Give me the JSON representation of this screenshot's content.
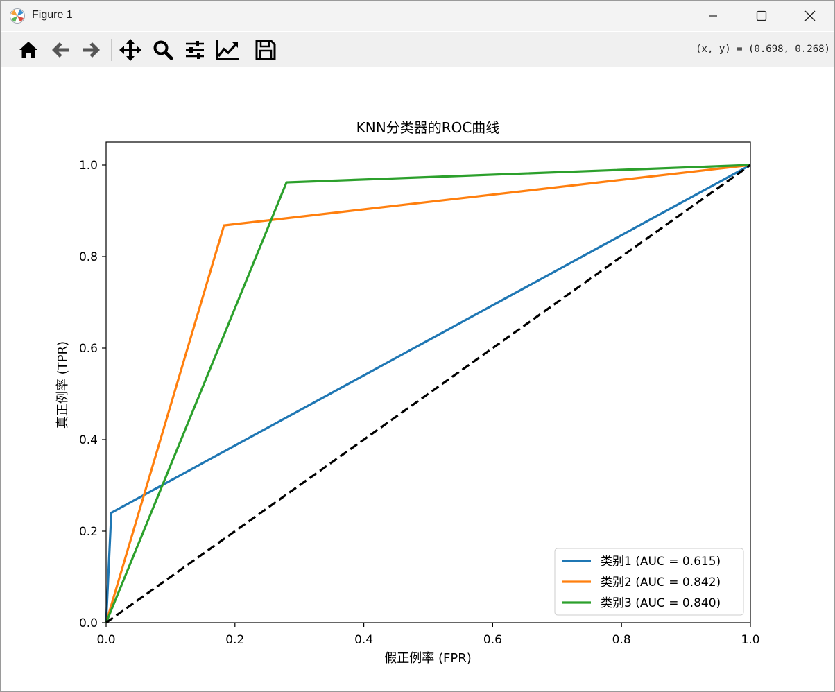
{
  "window": {
    "title": "Figure 1",
    "controls": [
      "minimize",
      "maximize",
      "close"
    ]
  },
  "toolbar": {
    "buttons": [
      {
        "name": "home",
        "icon": "home-icon"
      },
      {
        "name": "back",
        "icon": "arrow-left-icon"
      },
      {
        "name": "forward",
        "icon": "arrow-right-icon"
      },
      {
        "name": "pan",
        "icon": "move-icon"
      },
      {
        "name": "zoom",
        "icon": "zoom-icon"
      },
      {
        "name": "configure-subplots",
        "icon": "sliders-icon"
      },
      {
        "name": "edit-axis",
        "icon": "line-chart-icon"
      },
      {
        "name": "save",
        "icon": "floppy-disk-icon"
      }
    ],
    "coords": "(x, y) = (0.698, 0.268)"
  },
  "chart_data": {
    "type": "line",
    "title": "KNN分类器的ROC曲线",
    "xlabel": "假正例率 (FPR)",
    "ylabel": "真正例率 (TPR)",
    "xlim": [
      0.0,
      1.0
    ],
    "ylim": [
      0.0,
      1.05
    ],
    "xticks": [
      "0.0",
      "0.2",
      "0.4",
      "0.6",
      "0.8",
      "1.0"
    ],
    "yticks": [
      "0.0",
      "0.2",
      "0.4",
      "0.6",
      "0.8",
      "1.0"
    ],
    "grid": false,
    "legend_position": "lower-right",
    "series": [
      {
        "name": "类别1 (AUC = 0.615)",
        "color": "#1f77b4",
        "style": "solid",
        "x": [
          0.0,
          0.008,
          1.0
        ],
        "y": [
          0.0,
          0.24,
          1.0
        ]
      },
      {
        "name": "类别2 (AUC = 0.842)",
        "color": "#ff7f0e",
        "style": "solid",
        "x": [
          0.0,
          0.183,
          1.0
        ],
        "y": [
          0.0,
          0.868,
          1.0
        ]
      },
      {
        "name": "类别3 (AUC = 0.840)",
        "color": "#2ca02c",
        "style": "solid",
        "x": [
          0.0,
          0.28,
          1.0
        ],
        "y": [
          0.0,
          0.962,
          1.0
        ]
      }
    ],
    "reference_line": {
      "color": "#000000",
      "style": "dashed",
      "x": [
        0.0,
        1.0
      ],
      "y": [
        0.0,
        1.0
      ]
    }
  }
}
